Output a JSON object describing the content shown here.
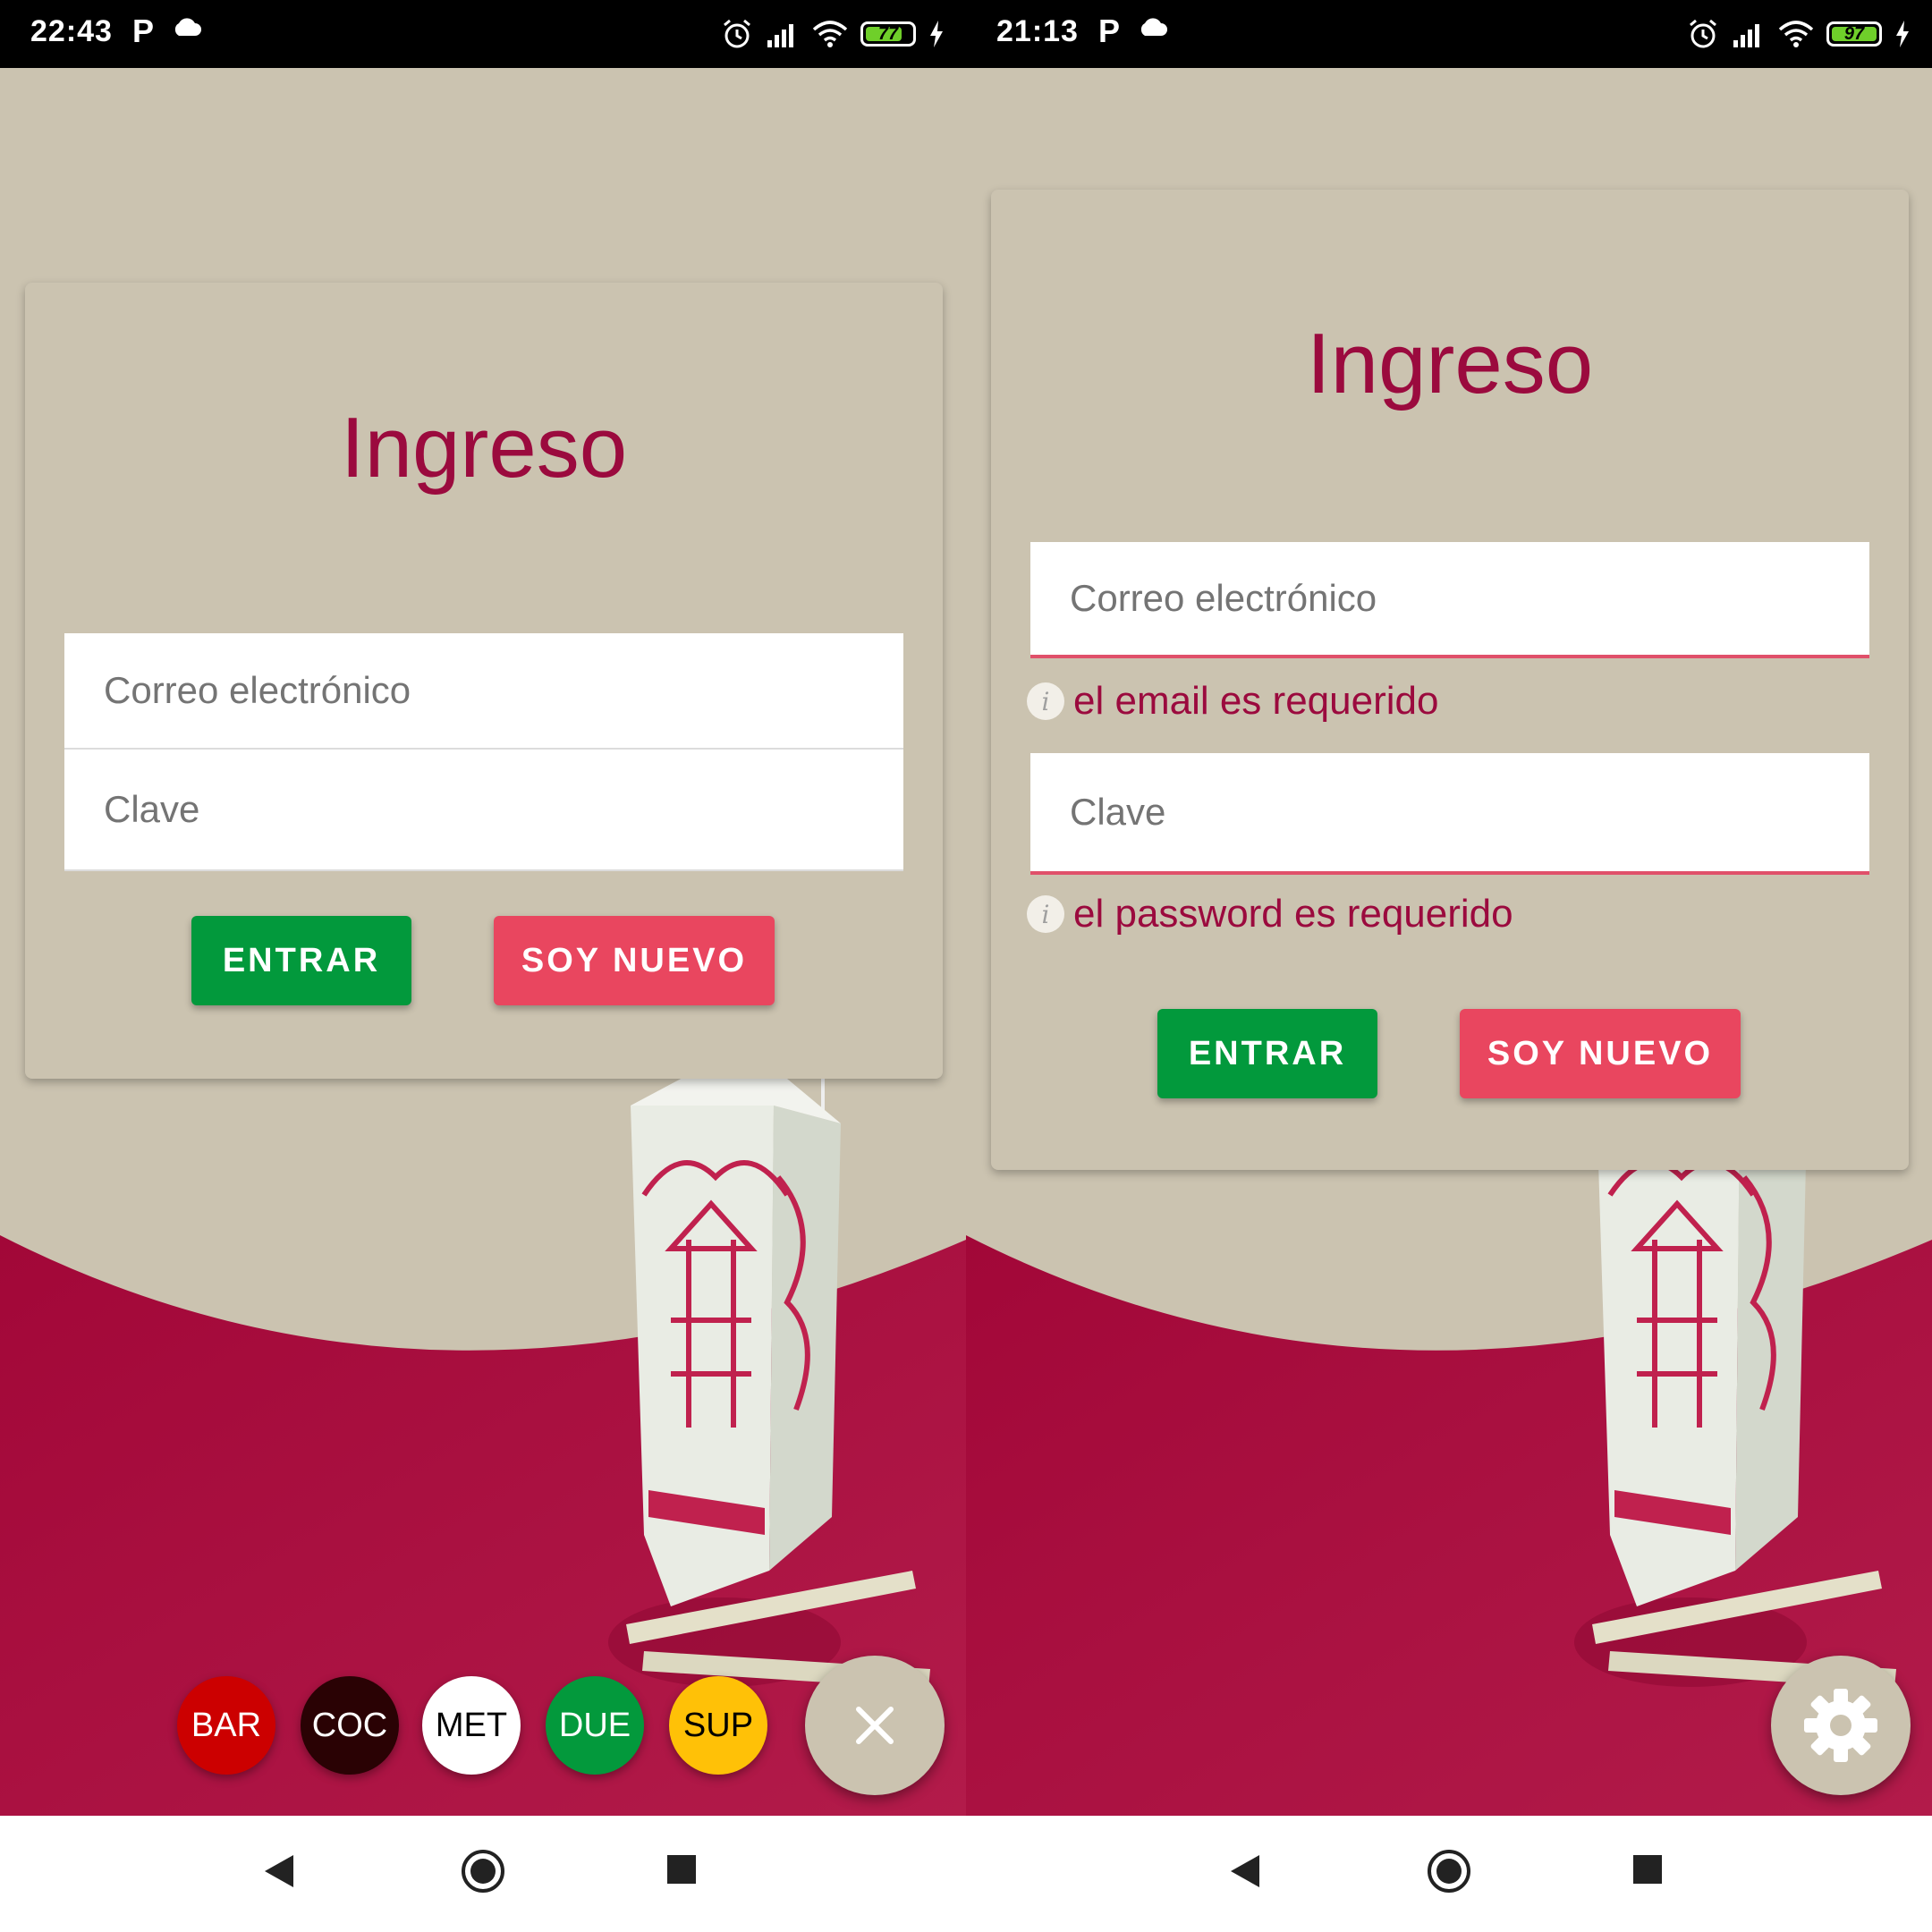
{
  "screens": [
    {
      "status": {
        "time": "22:43",
        "p_icon": "P",
        "battery": "77",
        "battery_level": 0.77
      },
      "title": "Ingreso",
      "email_placeholder": "Correo electrónico",
      "password_placeholder": "Clave",
      "enter_label": "ENTRAR",
      "new_label": "SOY NUEVO",
      "dial": [
        {
          "label": "BAR",
          "bg": "#cc0000",
          "fg": "#ffffff"
        },
        {
          "label": "COC",
          "bg": "#2a0204",
          "fg": "#ffffff"
        },
        {
          "label": "MET",
          "bg": "#ffffff",
          "fg": "#000000"
        },
        {
          "label": "DUE",
          "bg": "#03993c",
          "fg": "#ffffff"
        },
        {
          "label": "SUP",
          "bg": "#ffc107",
          "fg": "#000000"
        }
      ],
      "fab_icon": "close-icon"
    },
    {
      "status": {
        "time": "21:13",
        "p_icon": "P",
        "battery": "97",
        "battery_level": 0.97
      },
      "title": "Ingreso",
      "email_placeholder": "Correo electrónico",
      "email_error": "el email es requerido",
      "password_placeholder": "Clave",
      "password_error": "el password es requerido",
      "enter_label": "ENTRAR",
      "new_label": "SOY NUEVO",
      "fab_icon": "gear-icon"
    }
  ],
  "colors": {
    "accent": "#9b0a3e",
    "background": "#cbc3b0",
    "green": "#02993c",
    "red": "#e9465f",
    "error_line": "#e0506a"
  },
  "icons": [
    "alarm-icon",
    "signal-icon",
    "wifi-icon",
    "battery-icon",
    "charging-icon",
    "cloud-icon",
    "back-icon",
    "home-icon",
    "recents-icon"
  ]
}
